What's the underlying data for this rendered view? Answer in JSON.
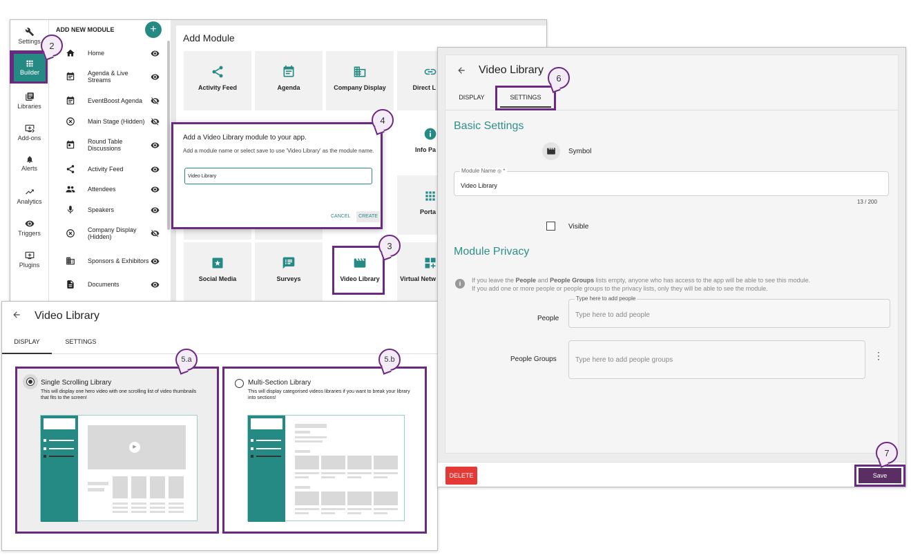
{
  "rail": {
    "items": [
      {
        "label": "Settings"
      },
      {
        "label": "Builder"
      },
      {
        "label": "Libraries"
      },
      {
        "label": "Add-ons"
      },
      {
        "label": "Alerts"
      },
      {
        "label": "Analytics"
      },
      {
        "label": "Triggers"
      },
      {
        "label": "Plugins"
      }
    ]
  },
  "module_list": {
    "header": "ADD NEW MODULE",
    "add_label": "+",
    "items": [
      {
        "label": "Home"
      },
      {
        "label": "Agenda & Live Streams"
      },
      {
        "label": "EventBoost Agenda"
      },
      {
        "label": "Main Stage (Hidden)"
      },
      {
        "label": "Round Table Discussions"
      },
      {
        "label": "Activity Feed"
      },
      {
        "label": "Attendees"
      },
      {
        "label": "Speakers"
      },
      {
        "label": "Company Display (Hidden)"
      },
      {
        "label": "Sponsors & Exhibitors"
      },
      {
        "label": "Documents"
      }
    ]
  },
  "add_module": {
    "title": "Add Module",
    "tiles": [
      {
        "label": "Activity Feed"
      },
      {
        "label": "Agenda"
      },
      {
        "label": "Company Display"
      },
      {
        "label": "Direct L"
      },
      {
        "label": "Info Pa"
      },
      {
        "label": "Porta"
      },
      {
        "label": "Social Media"
      },
      {
        "label": "Surveys"
      },
      {
        "label": "Video Library"
      },
      {
        "label": "Virtual Netw"
      }
    ]
  },
  "dialog": {
    "title": "Add a Video Library module to your app.",
    "subtitle": "Add a module name or select save to use 'Video Library' as the module name.",
    "input_value": "Video Library",
    "cancel": "CANCEL",
    "create": "CREATE"
  },
  "callouts": {
    "c2": "2",
    "c3": "3",
    "c4": "4",
    "c5a": "5.a",
    "c5b": "5.b",
    "c6": "6",
    "c7": "7"
  },
  "display_panel": {
    "title": "Video Library",
    "tabs": [
      "DISPLAY",
      "SETTINGS"
    ],
    "option_a": {
      "title": "Single Scrolling Library",
      "desc": "This will display one hero video with one scrolling list of video thumbnails that fits to the screen!"
    },
    "option_b": {
      "title": "Multi-Section Library",
      "desc": "This will display categorised videos libraries if you want to break your library into sections!"
    }
  },
  "settings_panel": {
    "title": "Video Library",
    "tabs": [
      "DISPLAY",
      "SETTINGS"
    ],
    "basic_heading": "Basic Settings",
    "symbol_label": "Symbol",
    "module_name_label": "Module Name",
    "module_name_value": "Video Library",
    "char_count": "13 / 200",
    "visible_label": "Visible",
    "privacy_heading": "Module Privacy",
    "privacy_pre": "If you leave the ",
    "privacy_people": "People",
    "privacy_and": " and ",
    "privacy_groups": "People Groups",
    "privacy_rest": " lists empty, anyone who has access to the app will be able to see this module.",
    "privacy_line2": "If you add one or more people or people groups to the privacy lists, only they will be able to see the module.",
    "people_label": "People",
    "people_float": "Type here to add people",
    "people_placeholder": "Type here to add people",
    "groups_label": "People Groups",
    "groups_placeholder": "Type here to add people groups",
    "delete": "DELETE",
    "save": "Save"
  },
  "colors": {
    "teal": "#268a84",
    "purple_highlight": "#6b2a82",
    "delete_red": "#e53935",
    "save_bg": "#5a2d63"
  }
}
